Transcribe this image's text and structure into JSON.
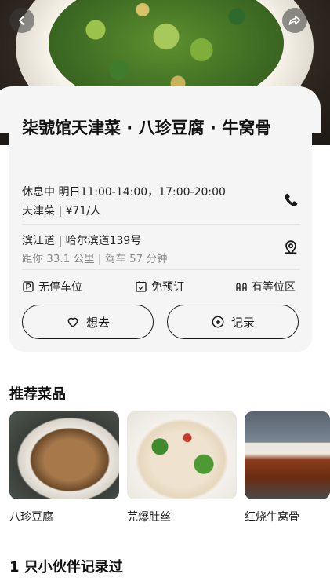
{
  "hero": {
    "back_icon": "chevron-left-icon",
    "share_icon": "share-icon"
  },
  "restaurant": {
    "name": "柒號馆天津菜 · 八珍豆腐 · 牛窝骨",
    "status": "休息中 明日11:00-14:00，17:00-20:00",
    "cuisine_price": "天津菜 | ¥71/人",
    "address": "滨江道 | 哈尔滨道139号",
    "distance": "距你 33.1 公里 | 驾车 57 分钟",
    "phone_icon": "phone-icon",
    "map_icon": "map-pin-icon"
  },
  "features": [
    {
      "icon": "parking-icon",
      "label": "无停车位"
    },
    {
      "icon": "calendar-check-icon",
      "label": "免预订"
    },
    {
      "icon": "waiting-area-icon",
      "label": "有等位区"
    }
  ],
  "actions": {
    "want_label": "想去",
    "record_label": "记录"
  },
  "recommended": {
    "title": "推荐菜品",
    "dishes": [
      {
        "name": "八珍豆腐"
      },
      {
        "name": "芫爆肚丝"
      },
      {
        "name": "红烧牛窝骨"
      }
    ]
  },
  "records": {
    "title": "1 只小伙伴记录过"
  },
  "colors": {
    "card_bg": "#f5f5f6",
    "text": "#1a1a1a",
    "muted": "#8a8a8a"
  }
}
